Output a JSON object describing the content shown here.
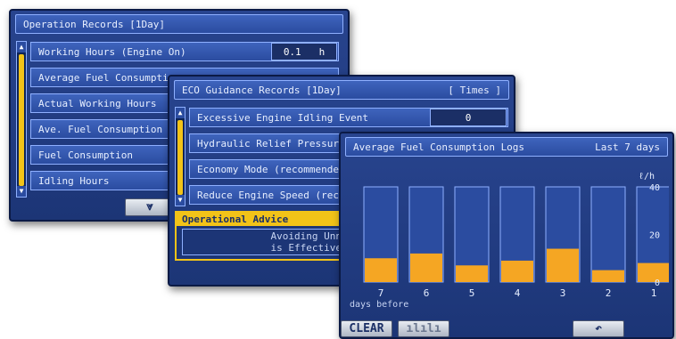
{
  "operation_records": {
    "title": "Operation Records  [1Day]",
    "rows": [
      {
        "label": "Working Hours (Engine On)",
        "value": "0.1",
        "unit": "h"
      },
      {
        "label": "Average Fuel Consumption",
        "value": "",
        "unit": ""
      },
      {
        "label": "Actual Working Hours",
        "value": "",
        "unit": ""
      },
      {
        "label": "Ave. Fuel Consumption (A",
        "value": "",
        "unit": ""
      },
      {
        "label": "Fuel Consumption",
        "value": "",
        "unit": ""
      },
      {
        "label": "Idling Hours",
        "value": "",
        "unit": ""
      }
    ],
    "page_down_icon": "double-chevron-down"
  },
  "eco_guidance": {
    "title": "ECO Guidance Records  [1Day]",
    "title_right": "[ Times ]",
    "rows": [
      {
        "label": "Excessive Engine Idling Event",
        "value": "0"
      },
      {
        "label": "Hydraulic Relief Pressure",
        "value": ""
      },
      {
        "label": "Economy Mode (recommended",
        "value": ""
      },
      {
        "label": "Reduce Engine Speed (reco",
        "value": ""
      }
    ],
    "advice_title": "Operational Advice",
    "advice_line1": "Avoiding Unnecessary Hyd",
    "advice_line2": "is Effective to Save Fue"
  },
  "fuel_logs": {
    "title": "Average Fuel Consumption Logs",
    "title_right": "Last 7 days",
    "clear_label": "CLEAR",
    "buttons_icons": [
      "bar-chart-icon",
      "return-icon"
    ],
    "colors": {
      "bar_bg": "#2b4ca0",
      "bar_fill": "#f5a623",
      "accent": "#f2c318"
    }
  },
  "chart_data": {
    "type": "bar",
    "categories": [
      "7",
      "6",
      "5",
      "4",
      "3",
      "2",
      "1"
    ],
    "values": [
      10,
      12,
      7,
      9,
      14,
      5,
      8
    ],
    "title": "Average Fuel Consumption Logs",
    "xlabel": "days before",
    "ylabel": "ℓ/h",
    "ylim": [
      0,
      40
    ],
    "yticks": [
      0,
      20,
      40
    ],
    "grid": false
  }
}
